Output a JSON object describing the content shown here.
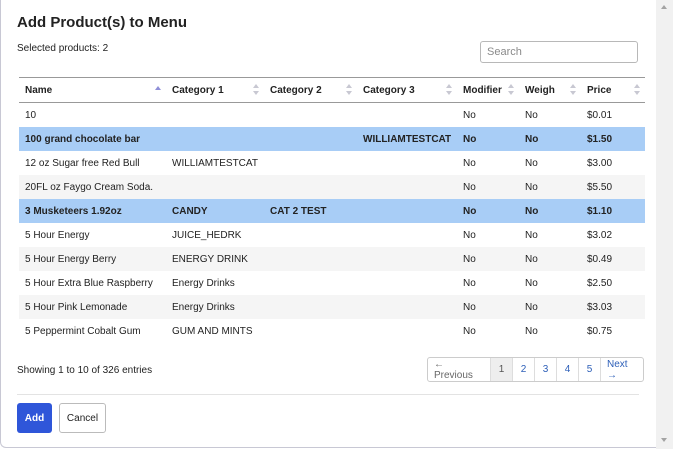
{
  "dialog": {
    "title": "Add Product(s) to Menu",
    "selected_text": "Selected products: 2"
  },
  "search": {
    "placeholder": "Search",
    "value": ""
  },
  "table": {
    "columns": [
      "Name",
      "Category 1",
      "Category 2",
      "Category 3",
      "Modifier",
      "Weigh",
      "Price"
    ],
    "sorted_column": "Name",
    "rows": [
      {
        "name": "10",
        "cat1": "",
        "cat2": "",
        "cat3": "",
        "modifier": "No",
        "weigh": "No",
        "price": "$0.01"
      },
      {
        "name": "100 grand chocolate bar",
        "cat1": "",
        "cat2": "",
        "cat3": "WILLIAMTESTCAT",
        "modifier": "No",
        "weigh": "No",
        "price": "$1.50"
      },
      {
        "name": "12 oz Sugar free Red Bull",
        "cat1": "WILLIAMTESTCAT",
        "cat2": "",
        "cat3": "",
        "modifier": "No",
        "weigh": "No",
        "price": "$3.00"
      },
      {
        "name": "20FL oz Faygo Cream Soda.",
        "cat1": "",
        "cat2": "",
        "cat3": "",
        "modifier": "No",
        "weigh": "No",
        "price": "$5.50"
      },
      {
        "name": "3 Musketeers 1.92oz",
        "cat1": "CANDY",
        "cat2": "CAT 2 TEST",
        "cat3": "",
        "modifier": "No",
        "weigh": "No",
        "price": "$1.10"
      },
      {
        "name": "5 Hour Energy",
        "cat1": "JUICE_HEDRK",
        "cat2": "",
        "cat3": "",
        "modifier": "No",
        "weigh": "No",
        "price": "$3.02"
      },
      {
        "name": "5 Hour Energy Berry",
        "cat1": "ENERGY DRINK",
        "cat2": "",
        "cat3": "",
        "modifier": "No",
        "weigh": "No",
        "price": "$0.49"
      },
      {
        "name": "5 Hour Extra Blue Raspberry",
        "cat1": "Energy Drinks",
        "cat2": "",
        "cat3": "",
        "modifier": "No",
        "weigh": "No",
        "price": "$2.50"
      },
      {
        "name": "5 Hour Pink Lemonade",
        "cat1": "Energy Drinks",
        "cat2": "",
        "cat3": "",
        "modifier": "No",
        "weigh": "No",
        "price": "$3.03"
      },
      {
        "name": "5 Peppermint Cobalt Gum",
        "cat1": "GUM AND MINTS",
        "cat2": "",
        "cat3": "",
        "modifier": "No",
        "weigh": "No",
        "price": "$0.75"
      }
    ]
  },
  "pagination": {
    "info": "Showing 1 to 10 of 326 entries",
    "previous": "← Previous",
    "pages": [
      "1",
      "2",
      "3",
      "4",
      "5"
    ],
    "current_page": "1",
    "next": "Next →"
  },
  "footer": {
    "add_label": "Add",
    "cancel_label": "Cancel"
  },
  "colors": {
    "selected_row": "#a8cdf6",
    "primary_button": "#2f56d9",
    "link": "#2d5fb8"
  }
}
